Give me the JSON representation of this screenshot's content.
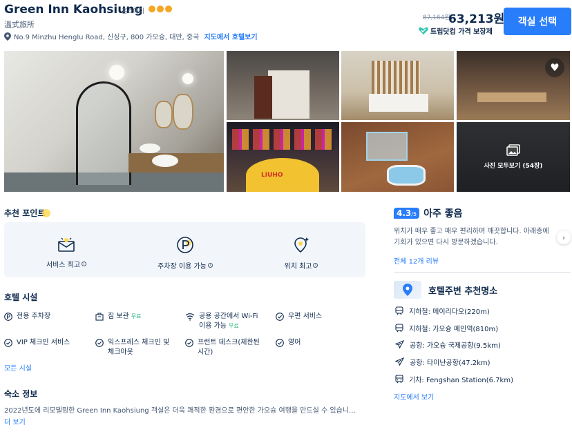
{
  "header": {
    "title": "Green Inn Kaohsiung",
    "hotel_type": "홈스테이",
    "star_count": 3,
    "subname": "溫式旅所",
    "address": "No.9 Minzhu Henglu Road, 신싱구, 800 가오슝, 대만, 중국",
    "map_link": "지도에서 호텔보기",
    "old_price": "87,164원",
    "price": "63,213원",
    "guarantee": "트립닷컴 가격 보장제",
    "select_button": "객실 선택",
    "accent_color": "#287dfa"
  },
  "gallery": {
    "sign_text": "LIUHO",
    "view_all": "사진 모두보기 (54장)"
  },
  "highlights": {
    "title": "추천 포인트",
    "items": [
      {
        "label": "서비스 최고",
        "icon": "service-icon"
      },
      {
        "label": "주차장 이용 가능",
        "icon": "parking-icon"
      },
      {
        "label": "위치 최고",
        "icon": "location-icon"
      }
    ]
  },
  "facilities": {
    "title": "호텔 시설",
    "items": [
      {
        "label": "전용 주차장",
        "tag": ""
      },
      {
        "label": "짐 보관",
        "tag": "무료"
      },
      {
        "label": "공용 공간에서 Wi-Fi",
        "label2": "이용 가능",
        "tag": "무료"
      },
      {
        "label": "우편 서비스",
        "tag": ""
      },
      {
        "label": "VIP 체크인 서비스",
        "tag": ""
      },
      {
        "label": "익스프레스 체크인 및",
        "label2": "체크아웃",
        "tag": ""
      },
      {
        "label": "프런트 데스크(제한된",
        "label2": "시간)",
        "tag": ""
      },
      {
        "label": "영어",
        "tag": ""
      }
    ],
    "all_link": "모든 시설"
  },
  "lodging": {
    "title": "숙소 정보",
    "description": "2022년도에 리모델링한 Green Inn Kaohsiung 객실은 더욱 쾌적한 환경으로 편안한 가오슝 여행을 만드실 수 있습니...",
    "more": "더 보기"
  },
  "reviews": {
    "score": "4.3",
    "score_max": "/5",
    "rating_word": "아주 좋음",
    "text": "위치가 매우 좋고 매우 편리하며 깨끗합니다. 아래층에 기회가 있으면 다시 방문하겠습니다.",
    "all_reviews": "전체 12개 리뷰"
  },
  "nearby": {
    "title": "호텔주변 추천명소",
    "items": [
      {
        "text": "지하철: 메이리다오(220m)",
        "icon": "subway-icon"
      },
      {
        "text": "지하철: 가오슝 메인역(810m)",
        "icon": "subway-icon"
      },
      {
        "text": "공항: 가오슝 국제공항(9.5km)",
        "icon": "airplane-icon"
      },
      {
        "text": "공항: 타이난공항(47.2km)",
        "icon": "airplane-icon"
      },
      {
        "text": "기차: Fengshan Station(6.7km)",
        "icon": "train-icon"
      }
    ],
    "map_link": "지도에서 보기"
  }
}
